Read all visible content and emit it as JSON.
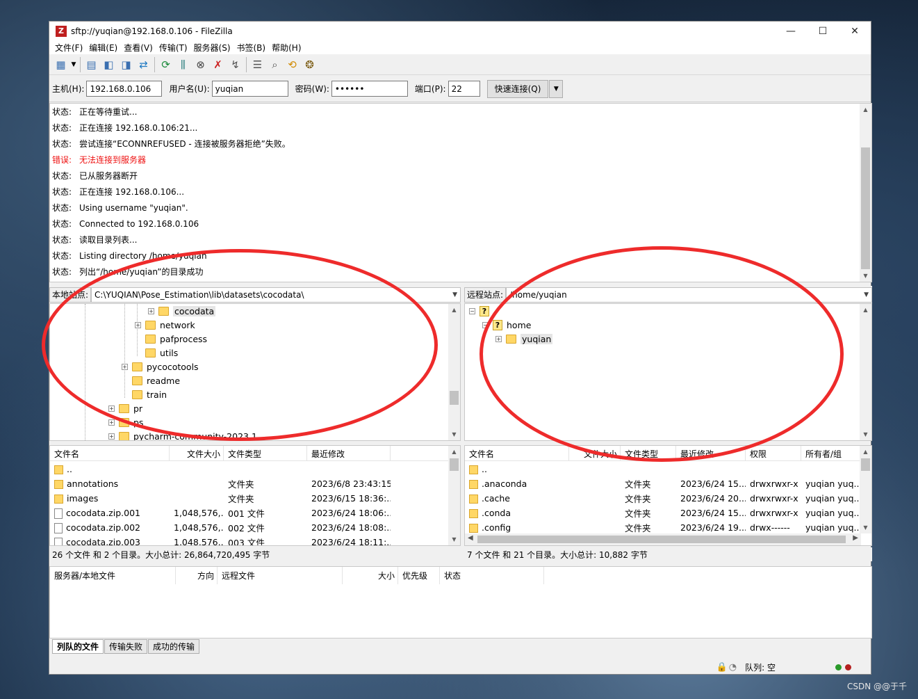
{
  "window": {
    "title": "sftp://yuqian@192.168.0.106 - FileZilla",
    "controls": {
      "minimize": "—",
      "maximize": "☐",
      "close": "✕"
    }
  },
  "menu": [
    "文件(F)",
    "编辑(E)",
    "查看(V)",
    "传输(T)",
    "服务器(S)",
    "书签(B)",
    "帮助(H)"
  ],
  "quickconnect": {
    "host_label": "主机(H):",
    "host_value": "192.168.0.106",
    "user_label": "用户名(U):",
    "user_value": "yuqian",
    "pass_label": "密码(W):",
    "pass_value": "••••••",
    "port_label": "端口(P):",
    "port_value": "22",
    "connect_button": "快速连接(Q)"
  },
  "log": [
    {
      "type": "状态:",
      "msg": "正在等待重试...",
      "error": false
    },
    {
      "type": "状态:",
      "msg": "正在连接 192.168.0.106:21...",
      "error": false
    },
    {
      "type": "状态:",
      "msg": "尝试连接“ECONNREFUSED - 连接被服务器拒绝”失败。",
      "error": false
    },
    {
      "type": "错误:",
      "msg": "无法连接到服务器",
      "error": true
    },
    {
      "type": "状态:",
      "msg": "已从服务器断开",
      "error": false
    },
    {
      "type": "状态:",
      "msg": "正在连接 192.168.0.106...",
      "error": false
    },
    {
      "type": "状态:",
      "msg": "Using username \"yuqian\".",
      "error": false
    },
    {
      "type": "状态:",
      "msg": "Connected to 192.168.0.106",
      "error": false
    },
    {
      "type": "状态:",
      "msg": "读取目录列表...",
      "error": false
    },
    {
      "type": "状态:",
      "msg": "Listing directory /home/yuqian",
      "error": false
    },
    {
      "type": "状态:",
      "msg": "列出“/home/yuqian”的目录成功",
      "error": false
    }
  ],
  "local": {
    "site_label": "本地站点:",
    "path": "C:\\YUQIAN\\Pose_Estimation\\lib\\datasets\\cocodata\\",
    "tree": [
      "cocodata",
      "network",
      "pafprocess",
      "utils",
      "pycocotools",
      "readme",
      "train",
      "pr",
      "ps",
      "pycharm-community-2023.1"
    ],
    "columns": [
      "文件名",
      "文件大小",
      "文件类型",
      "最近修改"
    ],
    "files": [
      {
        "name": "..",
        "size": "",
        "type": "",
        "modified": ""
      },
      {
        "name": "annotations",
        "size": "",
        "type": "文件夹",
        "modified": "2023/6/8 23:43:15"
      },
      {
        "name": "images",
        "size": "",
        "type": "文件夹",
        "modified": "2023/6/15 18:36:..."
      },
      {
        "name": "cocodata.zip.001",
        "size": "1,048,576,...",
        "type": "001 文件",
        "modified": "2023/6/24 18:06:..."
      },
      {
        "name": "cocodata.zip.002",
        "size": "1,048,576,...",
        "type": "002 文件",
        "modified": "2023/6/24 18:08:..."
      },
      {
        "name": "cocodata.zip.003",
        "size": "1,048,576,...",
        "type": "003 文件",
        "modified": "2023/6/24 18:11:..."
      }
    ],
    "status": "26 个文件 和 2 个目录。大小总计: 26,864,720,495 字节"
  },
  "remote": {
    "site_label": "远程站点:",
    "path": "/home/yuqian",
    "tree": [
      "?",
      "home",
      "yuqian"
    ],
    "columns": [
      "文件名",
      "文件大小",
      "文件类型",
      "最近修改",
      "权限",
      "所有者/组"
    ],
    "files": [
      {
        "name": "..",
        "size": "",
        "type": "",
        "modified": "",
        "perms": "",
        "owner": ""
      },
      {
        "name": ".anaconda",
        "size": "",
        "type": "文件夹",
        "modified": "2023/6/24 15...",
        "perms": "drwxrwxr-x",
        "owner": "yuqian yuq..."
      },
      {
        "name": ".cache",
        "size": "",
        "type": "文件夹",
        "modified": "2023/6/24 20...",
        "perms": "drwxrwxr-x",
        "owner": "yuqian yuq..."
      },
      {
        "name": ".conda",
        "size": "",
        "type": "文件夹",
        "modified": "2023/6/24 15...",
        "perms": "drwxrwxr-x",
        "owner": "yuqian yuq..."
      },
      {
        "name": ".config",
        "size": "",
        "type": "文件夹",
        "modified": "2023/6/24 19...",
        "perms": "drwx------",
        "owner": "yuqian yuq..."
      }
    ],
    "status": "7 个文件 和 21 个目录。大小总计: 10,882 字节"
  },
  "queue": {
    "columns": [
      "服务器/本地文件",
      "方向",
      "远程文件",
      "大小",
      "优先级",
      "状态"
    ],
    "tabs": [
      "列队的文件",
      "传输失败",
      "成功的传输"
    ]
  },
  "statusbar": {
    "queue_text": "队列: 空"
  },
  "watermark": "CSDN @@于千",
  "colors": {
    "annotation_circle": "#ee2b2b",
    "error_text": "#ee1111"
  }
}
